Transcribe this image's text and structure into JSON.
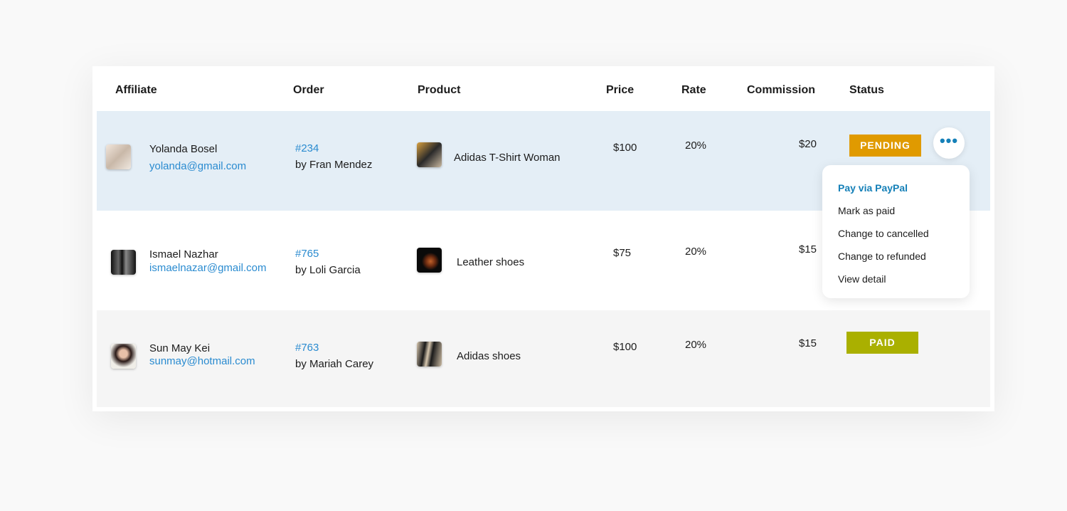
{
  "table": {
    "headers": [
      "Affiliate",
      "Order",
      "Product",
      "Price",
      "Rate",
      "Commission",
      "Status"
    ],
    "rows": [
      {
        "name": "Yolanda Bosel",
        "email": "yolanda@gmail.com",
        "order": "#234",
        "by": "by Fran Mendez",
        "product": "Adidas T-Shirt Woman",
        "price": "$100",
        "rate": "20%",
        "commission": "$20",
        "status": "PENDING"
      },
      {
        "name": "Ismael Nazhar",
        "email": "ismaelnazar@gmail.com",
        "order": "#765",
        "by": "by Loli Garcia",
        "product": "Leather shoes",
        "price": "$75",
        "rate": "20%",
        "commission": "$15",
        "status": ""
      },
      {
        "name": "Sun May Kei",
        "email": "sunmay@hotmail.com",
        "order": "#763",
        "by": "by Mariah Carey",
        "product": "Adidas shoes",
        "price": "$100",
        "rate": "20%",
        "commission": "$15",
        "status": "PAID"
      }
    ]
  },
  "more_button": {
    "icon": "more-horizontal-icon",
    "label": "•••"
  },
  "menu": {
    "items": [
      "Pay via PayPal",
      "Mark as paid",
      "Change to cancelled",
      "Change to refunded",
      "View detail"
    ]
  },
  "colors": {
    "pending": "#e09a00",
    "paid": "#aab000",
    "highlight_row": "#e4eef6",
    "link": "#2a8bd0",
    "menu_primary": "#1580b8"
  }
}
